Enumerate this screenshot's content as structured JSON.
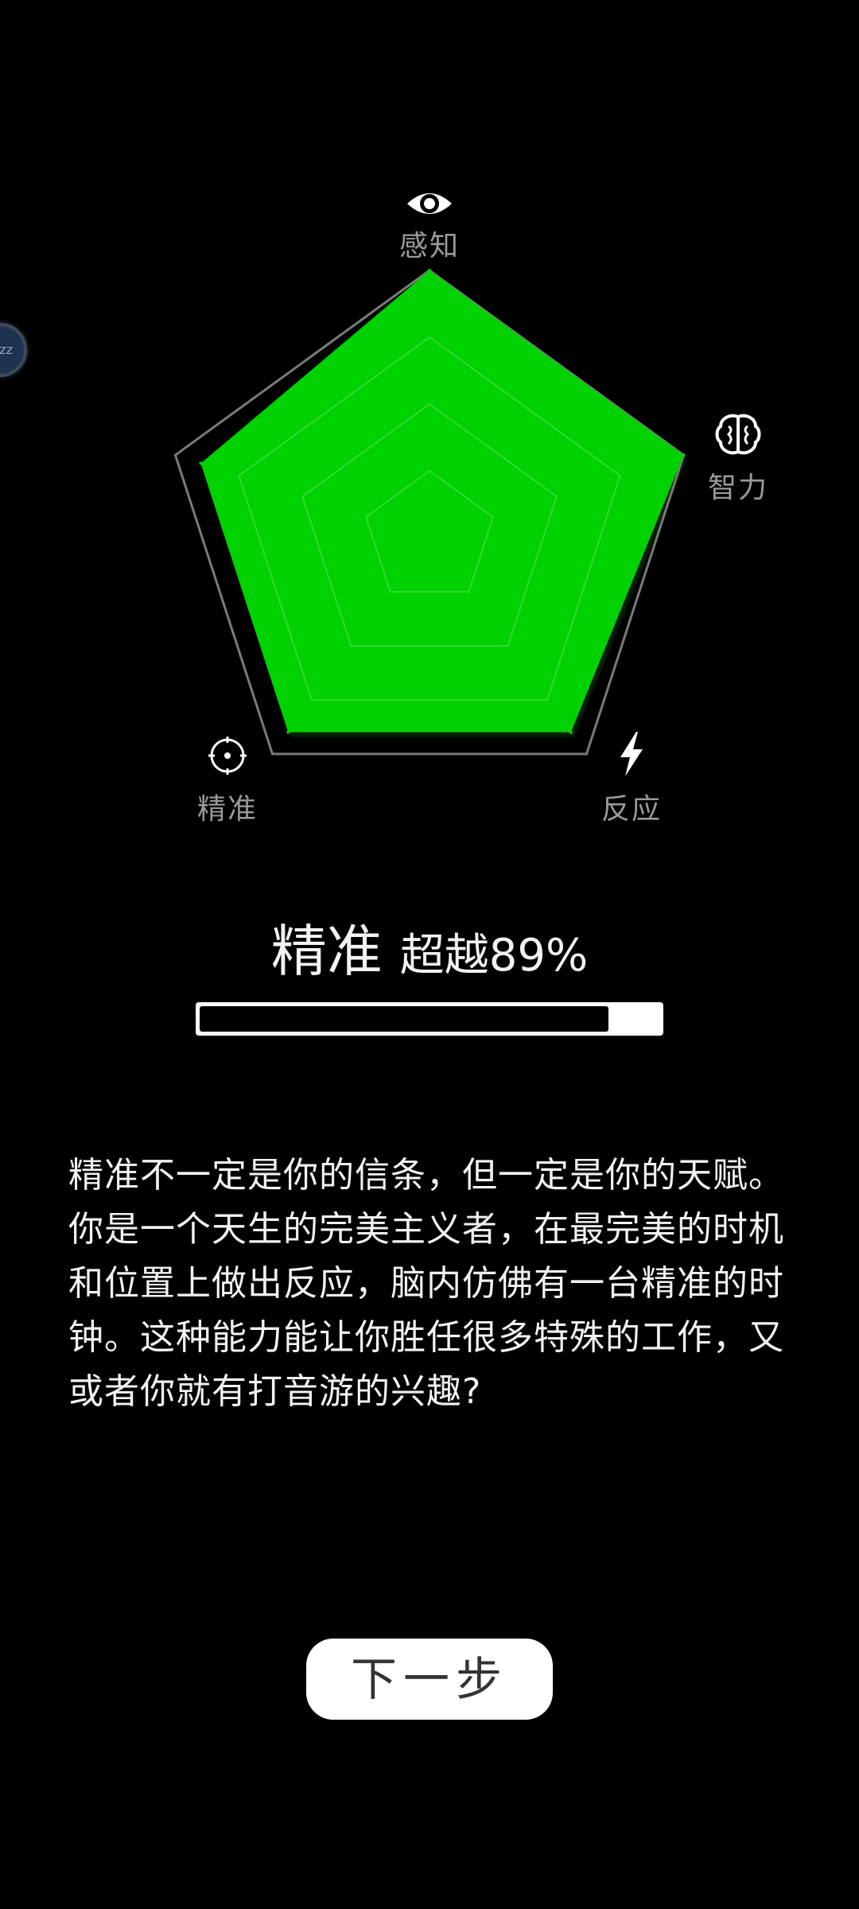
{
  "radar": {
    "axes": [
      {
        "key": "perception",
        "label": "感知",
        "icon": "eye-icon"
      },
      {
        "key": "intelligence",
        "label": "智力",
        "icon": "brain-icon"
      },
      {
        "key": "reaction",
        "label": "反应",
        "icon": "lightning-icon"
      },
      {
        "key": "precision",
        "label": "精准",
        "icon": "crosshair-icon"
      }
    ],
    "fill_color": "#00d100",
    "grid_color": "#7a7a7a"
  },
  "chart_data": {
    "type": "radar",
    "categories": [
      "感知",
      "智力",
      "反应",
      "",
      "精准"
    ],
    "values": [
      1.0,
      1.0,
      0.9,
      0.9,
      0.9
    ],
    "rlim": [
      0,
      1
    ]
  },
  "result": {
    "trait": "精准",
    "surpass_text": "超越89%",
    "progress_fraction": 0.89
  },
  "description": "精准不一定是你的信条，但一定是你的天赋。你是一个天生的完美主义者，在最完美的时机和位置上做出反应，脑内仿佛有一台精准的时钟。这种能力能让你胜任很多特殊的工作，又或者你就有打音游的兴趣?",
  "next_button_label": "下一步",
  "floating_bubble_text": "zz",
  "colors": {
    "background": "#000000",
    "text": "#f2f2f2",
    "accent_green": "#00d100"
  }
}
